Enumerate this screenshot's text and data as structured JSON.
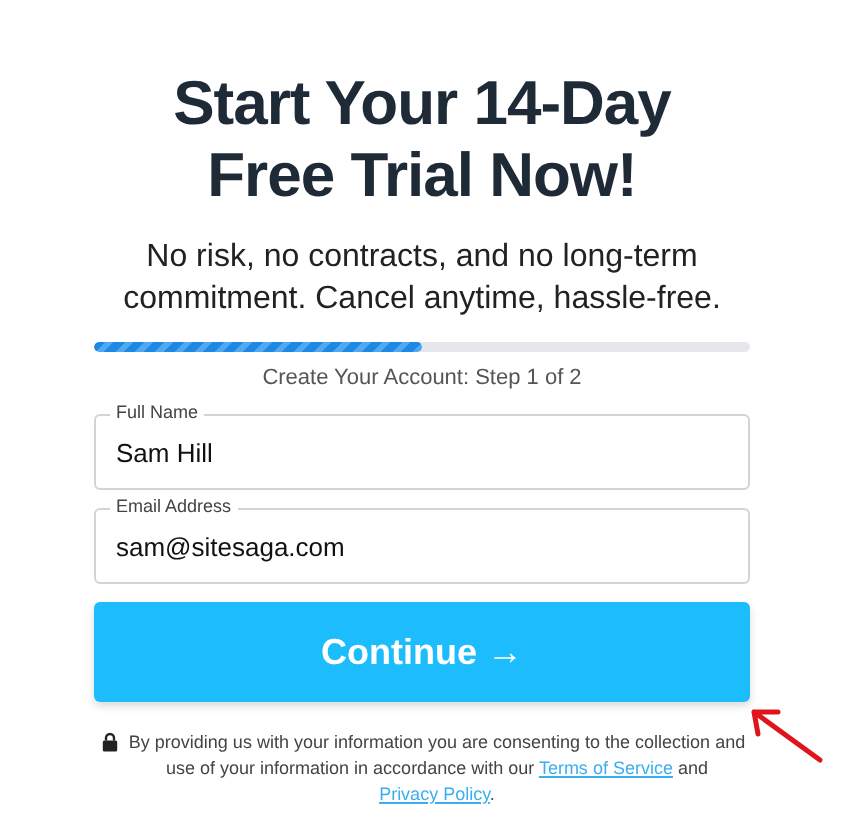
{
  "heading": [
    "Start Your 14-Day",
    "Free Trial Now!"
  ],
  "subheading": "No risk, no contracts, and no long-term commitment. Cancel anytime, hassle-free.",
  "progress": {
    "level": 0.5
  },
  "step_label": "Create Your Account: Step 1 of 2",
  "fields": [
    {
      "label": "Full Name",
      "value": "Sam Hill"
    },
    {
      "label": "Email Address",
      "value": "sam@sitesaga.com"
    }
  ],
  "button": "Continue →",
  "consent": [
    {
      "kind": "text",
      "text": "By providing us with your information you are consenting to the collection and use of your information in accordance with our "
    },
    {
      "kind": "link",
      "text": "Terms of Service"
    },
    {
      "kind": "text",
      "text": " and "
    },
    {
      "kind": "link",
      "text": "Privacy Policy"
    },
    {
      "kind": "text",
      "text": "."
    }
  ]
}
